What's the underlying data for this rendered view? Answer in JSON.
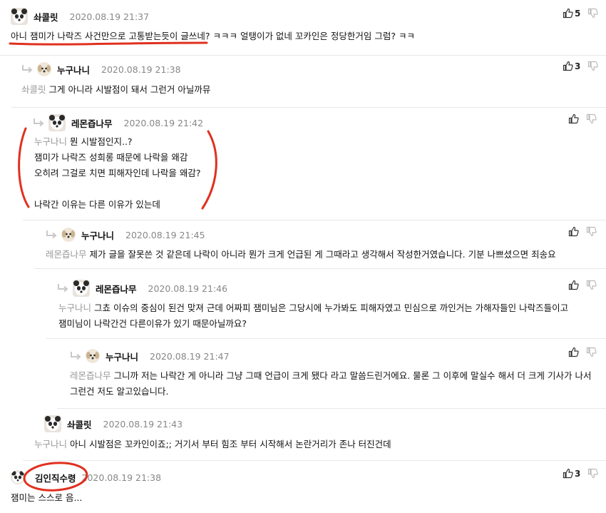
{
  "comments": [
    {
      "nick": "솨콜릿",
      "date": "2020.08.19 21:37",
      "mention": "",
      "text": "아니 잼미가 나락즈 사건만으로 고통받는듯이 글쓰네? ㅋㅋㅋ 얼탱이가 없네 꼬카인은 정당한거임 그럼? ㅋㅋ",
      "likes": "5",
      "avatar": "panda"
    },
    {
      "nick": "누구나니",
      "date": "2020.08.19 21:38",
      "mention": "솨콜릿",
      "text": "그게 아니라 시발점이 돼서 그런거 아닐까뮤",
      "likes": "3",
      "avatar": "dog"
    },
    {
      "nick": "레몬즙나무",
      "date": "2020.08.19 21:42",
      "mention": "누구나니",
      "text": "뭔 시발점인지..?\n잼미가 나락즈 성희롱 때문에 나락을 왜감\n오히려 그걸로 치면 피해자인데 나락을 왜감?\n\n나락간 이유는 다른 이유가 있는데",
      "likes": "",
      "avatar": "panda"
    },
    {
      "nick": "누구나니",
      "date": "2020.08.19 21:45",
      "mention": "레몬즙나무",
      "text": "제가 글을 잘못쓴 것 같은데 나락이 아니라 뭔가 크게 언급된 게 그때라고 생각해서 작성한거였습니다. 기분 나쁘셨으면 죄송요",
      "likes": "",
      "avatar": "dog"
    },
    {
      "nick": "레몬즙나무",
      "date": "2020.08.19 21:46",
      "mention": "누구나니",
      "text": "그쵸 이슈의 중심이 된건 맞져 근데 어짜피 잼미님은 그당시에 누가봐도 피해자였고 민심으로 까인거는 가해자들인 나락즈들이고\n잼미님이 나락간건 다른이유가 있기 때문아닐까요?",
      "likes": "",
      "avatar": "panda"
    },
    {
      "nick": "누구나니",
      "date": "2020.08.19 21:47",
      "mention": "레몬즙나무",
      "text": "그니까 저는 나락간 게 아니라 그냥 그때 언급이 크게 됐다 라고 말씀드린거에요. 물론 그 이후에 말실수 해서 더 크게 기사가 나서\n그런건 저도 알고있습니다.",
      "likes": "",
      "avatar": "dog"
    },
    {
      "nick": "솨콜릿",
      "date": "2020.08.19 21:43",
      "mention": "누구나니",
      "text": "아니 시발점은 꼬카인이죠;; 거기서 부터 힘조 부터 시작해서 논란거리가 존나 터진건데",
      "likes": "",
      "avatar": "panda"
    },
    {
      "nick": "김인직수령",
      "date": "2020.08.19 21:38",
      "mention": "",
      "text": "잼미는 스스로 음...",
      "likes": "3",
      "avatar": "panda"
    }
  ]
}
